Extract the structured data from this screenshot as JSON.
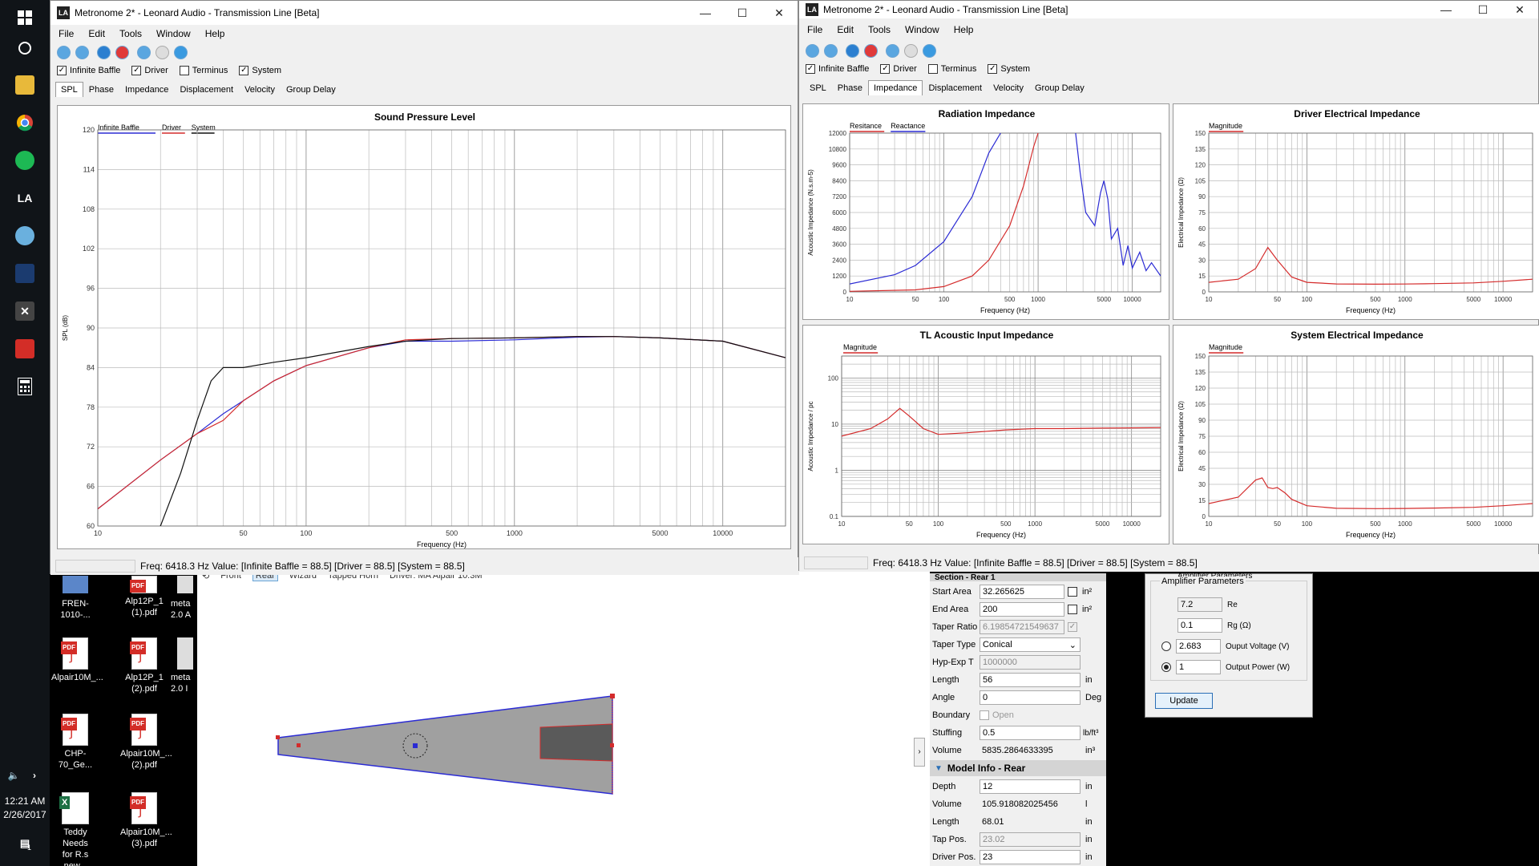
{
  "taskbar": {
    "time": "12:21 AM",
    "date": "2/26/2017",
    "notif_count": "1",
    "icons": [
      "windows-start-icon",
      "cortana-icon",
      "file-explorer-icon",
      "chrome-icon",
      "spotify-icon",
      "leonard-audio-icon",
      "paint-icon",
      "photoshop-icon",
      "x-app-icon",
      "pdf-app-icon",
      "calculator-icon"
    ]
  },
  "desktop": {
    "icons": [
      {
        "label": "FREN-1010-...",
        "type": "file"
      },
      {
        "label": "Alp12P_1\n(1).pdf",
        "type": "pdf"
      },
      {
        "label": "meta\n2.0 A",
        "type": "file"
      },
      {
        "label": "Alpair10M_...",
        "type": "pdf"
      },
      {
        "label": "Alp12P_1\n(2).pdf",
        "type": "pdf"
      },
      {
        "label": "meta\n2.0 I",
        "type": "file"
      },
      {
        "label": "CHP-70_Ge...",
        "type": "pdf"
      },
      {
        "label": "Alpair10M_...\n(2).pdf",
        "type": "pdf"
      },
      {
        "label": "Teddy Needs\nfor R.s new...",
        "type": "excel"
      },
      {
        "label": "Alpair10M_...\n(3).pdf",
        "type": "pdf"
      }
    ]
  },
  "left_window": {
    "title": "Metronome 2* - Leonard Audio - Transmission Line [Beta]",
    "menu": [
      "File",
      "Edit",
      "Tools",
      "Window",
      "Help"
    ],
    "checks": [
      {
        "label": "Infinite Baffle",
        "checked": true
      },
      {
        "label": "Driver",
        "checked": true
      },
      {
        "label": "Terminus",
        "checked": false
      },
      {
        "label": "System",
        "checked": true
      }
    ],
    "tabs": [
      "SPL",
      "Phase",
      "Impedance",
      "Displacement",
      "Velocity",
      "Group Delay"
    ],
    "active_tab": "SPL",
    "status": "Freq: 6418.3 Hz  Value: [Infinite Baffle = 88.5]  [Driver = 88.5]  [System = 88.5]"
  },
  "right_window": {
    "title": "Metronome 2* - Leonard Audio - Transmission Line [Beta]",
    "menu": [
      "File",
      "Edit",
      "Tools",
      "Window",
      "Help"
    ],
    "checks": [
      {
        "label": "Infinite Baffle",
        "checked": true
      },
      {
        "label": "Driver",
        "checked": true
      },
      {
        "label": "Terminus",
        "checked": false
      },
      {
        "label": "System",
        "checked": true
      }
    ],
    "tabs": [
      "SPL",
      "Phase",
      "Impedance",
      "Displacement",
      "Velocity",
      "Group Delay"
    ],
    "active_tab": "Impedance",
    "status": "Freq: 6418.3 Hz  Value: [Infinite Baffle = 88.5]  [Driver = 88.5]  [System = 88.5]"
  },
  "chart_data": [
    {
      "type": "line",
      "title": "Sound Pressure Level",
      "xlabel": "Frequency (Hz)",
      "ylabel": "SPL (dB)",
      "xscale": "log",
      "xlim": [
        10,
        20000
      ],
      "ylim": [
        60,
        120
      ],
      "yticks": [
        "60",
        "66",
        "72",
        "78",
        "84",
        "90",
        "96",
        "102",
        "108",
        "114",
        "120"
      ],
      "xticks": [
        "10",
        "50",
        "100",
        "500",
        "1000",
        "5000",
        "10000"
      ],
      "legend": [
        "Infinite Baffle",
        "Driver",
        "System"
      ],
      "series": [
        {
          "name": "Infinite Baffle",
          "color": "#2b2bd4",
          "x": [
            10,
            20,
            30,
            40,
            50,
            70,
            100,
            200,
            300,
            500,
            1000,
            2000,
            3000,
            5000,
            10000,
            20000
          ],
          "y": [
            62.6,
            70,
            74,
            77,
            79,
            82,
            84.3,
            87,
            88,
            88,
            88.2,
            88.6,
            88.7,
            88.5,
            88,
            85.5
          ]
        },
        {
          "name": "Driver",
          "color": "#d42b2b",
          "x": [
            10,
            20,
            30,
            40,
            50,
            70,
            100,
            200,
            300,
            500,
            1000,
            2000,
            3000,
            5000,
            10000,
            20000
          ],
          "y": [
            62.6,
            70,
            74,
            76,
            79,
            82,
            84.3,
            87,
            88.2,
            88.4,
            88.5,
            88.7,
            88.7,
            88.5,
            88,
            85.5
          ]
        },
        {
          "name": "System",
          "color": "#111111",
          "x": [
            10,
            20,
            25,
            30,
            35,
            40,
            50,
            70,
            100,
            200,
            300,
            500,
            1000,
            2000,
            3000,
            5000,
            10000,
            20000
          ],
          "y": [
            55,
            60,
            68,
            76,
            82,
            84,
            84,
            84.8,
            85.5,
            87.2,
            88,
            88.4,
            88.5,
            88.7,
            88.7,
            88.5,
            88,
            85.5
          ]
        }
      ]
    },
    {
      "type": "line",
      "title": "Radiation Impedance",
      "xlabel": "Frequency (Hz)",
      "ylabel": "Acoustic Impedance (N.s.m-5)",
      "xscale": "log",
      "xlim": [
        10,
        20000
      ],
      "ylim": [
        0,
        12000
      ],
      "yticks": [
        "0",
        "1200",
        "2400",
        "3600",
        "4800",
        "6000",
        "7200",
        "8400",
        "9600",
        "10800",
        "12000"
      ],
      "xticks": [
        "10",
        "50",
        "100",
        "500",
        "1000",
        "5000",
        "10000"
      ],
      "legend": [
        "Resitance",
        "Reactance"
      ],
      "series": [
        {
          "name": "Resitance",
          "color": "#d42b2b",
          "x": [
            10,
            50,
            100,
            200,
            300,
            500,
            700,
            900,
            1000
          ],
          "y": [
            40,
            150,
            400,
            1200,
            2400,
            5000,
            8000,
            11000,
            12000
          ]
        },
        {
          "name": "Reactance",
          "color": "#2b2bd4",
          "x": [
            10,
            30,
            50,
            100,
            200,
            300,
            400
          ],
          "y": [
            600,
            1300,
            2000,
            3800,
            7200,
            10500,
            12000
          ]
        },
        {
          "name": "Reactance-high",
          "color": "#2b2bd4",
          "x": [
            2500,
            2800,
            3200,
            4000,
            4600,
            5000,
            5500,
            6000,
            7000,
            8000,
            9000,
            10000,
            12000,
            14000,
            16000,
            20000
          ],
          "y": [
            12000,
            9000,
            6000,
            5000,
            7500,
            8400,
            7000,
            4000,
            4800,
            2000,
            3500,
            1800,
            3000,
            1600,
            2200,
            1200
          ]
        }
      ]
    },
    {
      "type": "line",
      "title": "Driver Electrical Impedance",
      "xlabel": "Frequency (Hz)",
      "ylabel": "Electrical Impedance (Ω)",
      "xscale": "log",
      "xlim": [
        10,
        20000
      ],
      "ylim": [
        0,
        150
      ],
      "yticks": [
        "0",
        "15",
        "30",
        "45",
        "60",
        "75",
        "90",
        "105",
        "120",
        "135",
        "150"
      ],
      "xticks": [
        "10",
        "50",
        "100",
        "500",
        "1000",
        "5000",
        "10000"
      ],
      "legend": [
        "Magnitude"
      ],
      "series": [
        {
          "name": "Magnitude",
          "color": "#d42b2b",
          "x": [
            10,
            20,
            30,
            40,
            50,
            70,
            100,
            200,
            500,
            1000,
            2000,
            5000,
            10000,
            20000
          ],
          "y": [
            9,
            12,
            22,
            42,
            30,
            14,
            9,
            7.5,
            7.3,
            7.4,
            7.8,
            8.5,
            10,
            12
          ]
        }
      ]
    },
    {
      "type": "line",
      "title": "TL Acoustic Input Impedance",
      "xlabel": "Frequency (Hz)",
      "ylabel": "Acoustic Impedance / pc",
      "xscale": "log",
      "yscale": "log",
      "xlim": [
        10,
        20000
      ],
      "ylim": [
        0.1,
        300
      ],
      "yticks": [
        "0.1",
        "1",
        "10",
        "100"
      ],
      "xticks": [
        "10",
        "50",
        "100",
        "500",
        "1000",
        "5000",
        "10000"
      ],
      "legend": [
        "Magnitude"
      ],
      "series": [
        {
          "name": "Magnitude",
          "color": "#d42b2b",
          "x": [
            10,
            20,
            30,
            40,
            50,
            70,
            100,
            200,
            500,
            1000,
            2000,
            5000,
            10000,
            20000
          ],
          "y": [
            5.5,
            8,
            13,
            22,
            15,
            8,
            6,
            6.5,
            7.5,
            8,
            8,
            8.2,
            8.3,
            8.4
          ]
        }
      ]
    },
    {
      "type": "line",
      "title": "System Electrical Impedance",
      "xlabel": "Frequency (Hz)",
      "ylabel": "Electrical Impedance (Ω)",
      "xscale": "log",
      "xlim": [
        10,
        20000
      ],
      "ylim": [
        0,
        150
      ],
      "yticks": [
        "0",
        "15",
        "30",
        "45",
        "60",
        "75",
        "90",
        "105",
        "120",
        "135",
        "150"
      ],
      "xticks": [
        "10",
        "50",
        "100",
        "500",
        "1000",
        "5000",
        "10000"
      ],
      "legend": [
        "Magnitude"
      ],
      "series": [
        {
          "name": "Magnitude",
          "color": "#d42b2b",
          "x": [
            10,
            20,
            30,
            35,
            40,
            45,
            50,
            60,
            70,
            100,
            200,
            500,
            1000,
            2000,
            5000,
            10000,
            20000
          ],
          "y": [
            12,
            18,
            34,
            36,
            27,
            26,
            27,
            22,
            16,
            10,
            7.6,
            7.3,
            7.4,
            7.8,
            8.5,
            10,
            12
          ]
        }
      ]
    }
  ],
  "model_view": {
    "toolbar_items": [
      "Front",
      "Rear",
      "Wizard",
      "Tapped Horn",
      "Driver: MA Alpair 10.3M"
    ]
  },
  "properties": {
    "top_section": "Section - Rear 1",
    "rows_top": [
      {
        "label": "Start Area",
        "value": "32.265625",
        "unit": "in²",
        "check": true
      },
      {
        "label": "End Area",
        "value": "200",
        "unit": "in²",
        "check": true
      },
      {
        "label": "Taper Ratio",
        "value": "6.19854721549637",
        "unit": "",
        "disabled": true,
        "check": true
      },
      {
        "label": "Taper Type",
        "value": "Conical",
        "unit": "",
        "dropdown": true
      },
      {
        "label": "Hyp-Exp T",
        "value": "1000000",
        "unit": "",
        "disabled": true
      },
      {
        "label": "Length",
        "value": "56",
        "unit": "in"
      },
      {
        "label": "Angle",
        "value": "0",
        "unit": "Deg"
      },
      {
        "label": "Boundary",
        "value": "Open",
        "unit": "",
        "checkbox_only": true
      },
      {
        "label": "Stuffing",
        "value": "0.5",
        "unit": "lb/ft³"
      },
      {
        "label": "Volume",
        "value": "5835.2864633395",
        "unit": "in³",
        "readonly": true
      }
    ],
    "section_title": "Model Info - Rear",
    "rows_bottom": [
      {
        "label": "Depth",
        "value": "12",
        "unit": "in"
      },
      {
        "label": "Volume",
        "value": "105.918082025456",
        "unit": "l",
        "readonly": true
      },
      {
        "label": "Length",
        "value": "68.01",
        "unit": "in",
        "readonly": true
      },
      {
        "label": "Tap Pos.",
        "value": "23.02",
        "unit": "in",
        "disabled": true
      },
      {
        "label": "Driver Pos.",
        "value": "23",
        "unit": "in"
      }
    ]
  },
  "amplifier": {
    "header": "Amplifier Parameters",
    "group_label": "Amplifier Parameters",
    "re_value": "7.2",
    "re_label": "Re",
    "rg_value": "0.1",
    "rg_label": "Rg (Ω)",
    "voltage_value": "2.683",
    "voltage_label": "Ouput Voltage (V)",
    "power_value": "1",
    "power_label": "Output Power (W)",
    "update_label": "Update"
  }
}
